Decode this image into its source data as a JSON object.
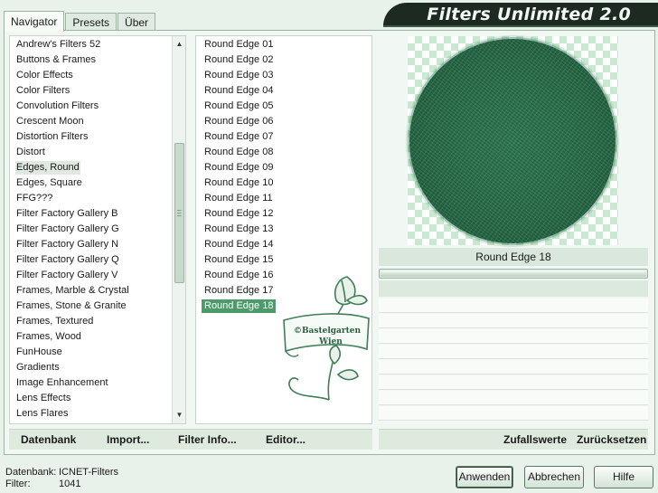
{
  "title": "Filters Unlimited 2.0",
  "tabs": [
    {
      "label": "Navigator"
    },
    {
      "label": "Presets"
    },
    {
      "label": "Über"
    }
  ],
  "categories": [
    "Andrew's Filters 52",
    "Buttons & Frames",
    "Color Effects",
    "Color Filters",
    "Convolution Filters",
    "Crescent Moon",
    "Distortion Filters",
    "Distort",
    "Edges, Round",
    "Edges, Square",
    "FFG???",
    "Filter Factory Gallery B",
    "Filter Factory Gallery G",
    "Filter Factory Gallery N",
    "Filter Factory Gallery Q",
    "Filter Factory Gallery V",
    "Frames, Marble & Crystal",
    "Frames, Stone & Granite",
    "Frames, Textured",
    "Frames, Wood",
    "FunHouse",
    "Gradients",
    "Image Enhancement",
    "Lens Effects",
    "Lens Flares"
  ],
  "selected_category": "Edges, Round",
  "filters": [
    "Round Edge 01",
    "Round Edge 02",
    "Round Edge 03",
    "Round Edge 04",
    "Round Edge 05",
    "Round Edge 06",
    "Round Edge 07",
    "Round Edge 08",
    "Round Edge 09",
    "Round Edge 10",
    "Round Edge 11",
    "Round Edge 12",
    "Round Edge 13",
    "Round Edge 14",
    "Round Edge 15",
    "Round Edge 16",
    "Round Edge 17",
    "Round Edge 18"
  ],
  "selected_filter": "Round Edge 18",
  "preview_filter_name": "Round Edge 18",
  "watermark": {
    "line1": "©Bastelgarten",
    "line2": "Wien"
  },
  "links_left": {
    "database": "Datenbank",
    "import": "Import...",
    "filter_info": "Filter Info...",
    "editor": "Editor..."
  },
  "links_right": {
    "random": "Zufallswerte",
    "reset": "Zurücksetzen"
  },
  "status": {
    "db_label": "Datenbank:",
    "db_value": "ICNET-Filters",
    "filter_label": "Filter:",
    "filter_value": "1041"
  },
  "buttons": {
    "apply": "Anwenden",
    "cancel": "Abbrechen",
    "help": "Hilfe"
  },
  "colors": {
    "accent": "#4e9a6b",
    "background": "#e8f1ea",
    "title_bar": "#1d2a22"
  }
}
